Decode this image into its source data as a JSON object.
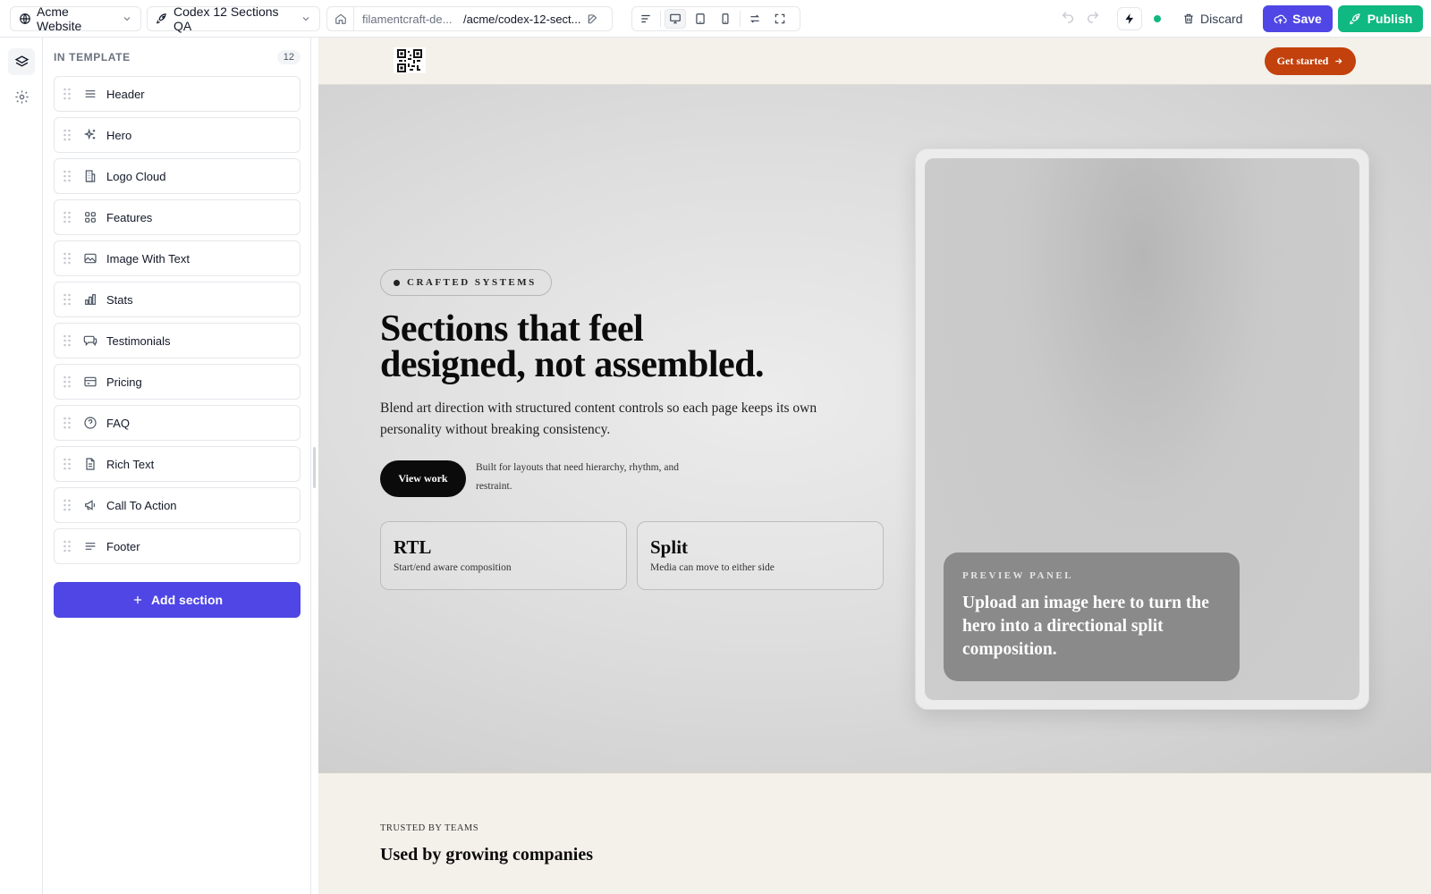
{
  "toolbar": {
    "site_selector": "Acme Website",
    "page_selector": "Codex 12 Sections QA",
    "url_domain": "filamentcraft-de...",
    "url_path": "/acme/codex-12-sect...",
    "discard_label": "Discard",
    "save_label": "Save",
    "publish_label": "Publish",
    "status_color": "#10b981",
    "accent_color": "#4f46e5",
    "publish_color": "#10b981"
  },
  "sidebar": {
    "title": "IN TEMPLATE",
    "count": "12",
    "sections": [
      {
        "label": "Header",
        "icon": "menu-icon"
      },
      {
        "label": "Hero",
        "icon": "sparkles-icon"
      },
      {
        "label": "Logo Cloud",
        "icon": "building-icon"
      },
      {
        "label": "Features",
        "icon": "grid-icon"
      },
      {
        "label": "Image With Text",
        "icon": "image-icon"
      },
      {
        "label": "Stats",
        "icon": "bar-chart-icon"
      },
      {
        "label": "Testimonials",
        "icon": "chat-icon"
      },
      {
        "label": "Pricing",
        "icon": "credit-card-icon"
      },
      {
        "label": "FAQ",
        "icon": "question-icon"
      },
      {
        "label": "Rich Text",
        "icon": "document-icon"
      },
      {
        "label": "Call To Action",
        "icon": "megaphone-icon"
      },
      {
        "label": "Footer",
        "icon": "lines-icon"
      }
    ],
    "add_section_label": "Add section"
  },
  "canvas": {
    "header": {
      "cta_label": "Get started",
      "cta_color": "#c2410c"
    },
    "hero": {
      "eyebrow": "CRAFTED SYSTEMS",
      "title_line1": "Sections that feel",
      "title_line2": "designed, not assembled.",
      "subtitle": "Blend art direction with structured content controls so each page keeps its own personality without breaking consistency.",
      "primary_cta": "View work",
      "note": "Built for layouts that need hierarchy, rhythm, and restraint.",
      "cards": [
        {
          "title": "RTL",
          "desc": "Start/end aware composition"
        },
        {
          "title": "Split",
          "desc": "Media can move to either side"
        }
      ],
      "preview_label": "PREVIEW PANEL",
      "preview_text": "Upload an image here to turn the hero into a directional split composition."
    },
    "logo_cloud": {
      "eyebrow": "TRUSTED BY TEAMS",
      "title": "Used by growing companies"
    }
  }
}
